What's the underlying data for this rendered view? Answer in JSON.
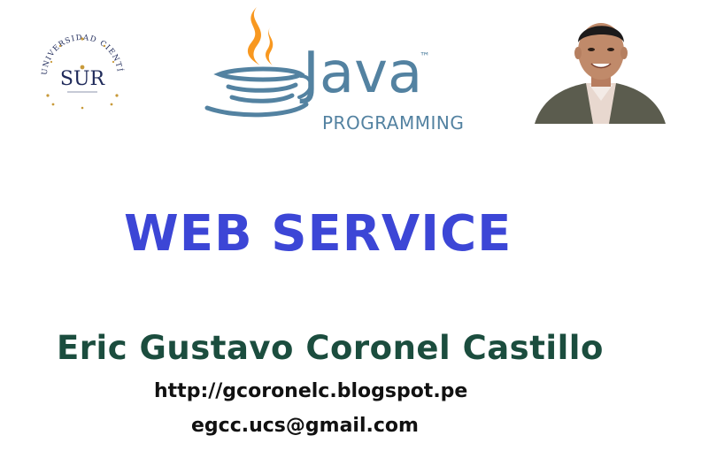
{
  "header": {
    "sur_logo_text": "SUR",
    "sur_logo_ring_text": "UNIVERSIDAD CIENTÍFICA DEL",
    "java_word": "Java",
    "java_tm": "™",
    "java_subtitle": "PROGRAMMING"
  },
  "main": {
    "title": "WEB SERVICE",
    "author": "Eric Gustavo Coronel Castillo",
    "blog_url": "http://gcoronelc.blogspot.pe",
    "email": "egcc.ucs@gmail.com"
  },
  "colors": {
    "title": "#3c46d6",
    "author": "#1b4d3e",
    "java_blue": "#5382a1",
    "java_orange": "#f89820",
    "sur_navy": "#1f2a5a",
    "sur_gold": "#c89a3a"
  },
  "icons": {
    "sur_logo": "university-seal-icon",
    "java_logo": "java-coffee-cup-icon",
    "photo": "person-portrait-icon"
  }
}
